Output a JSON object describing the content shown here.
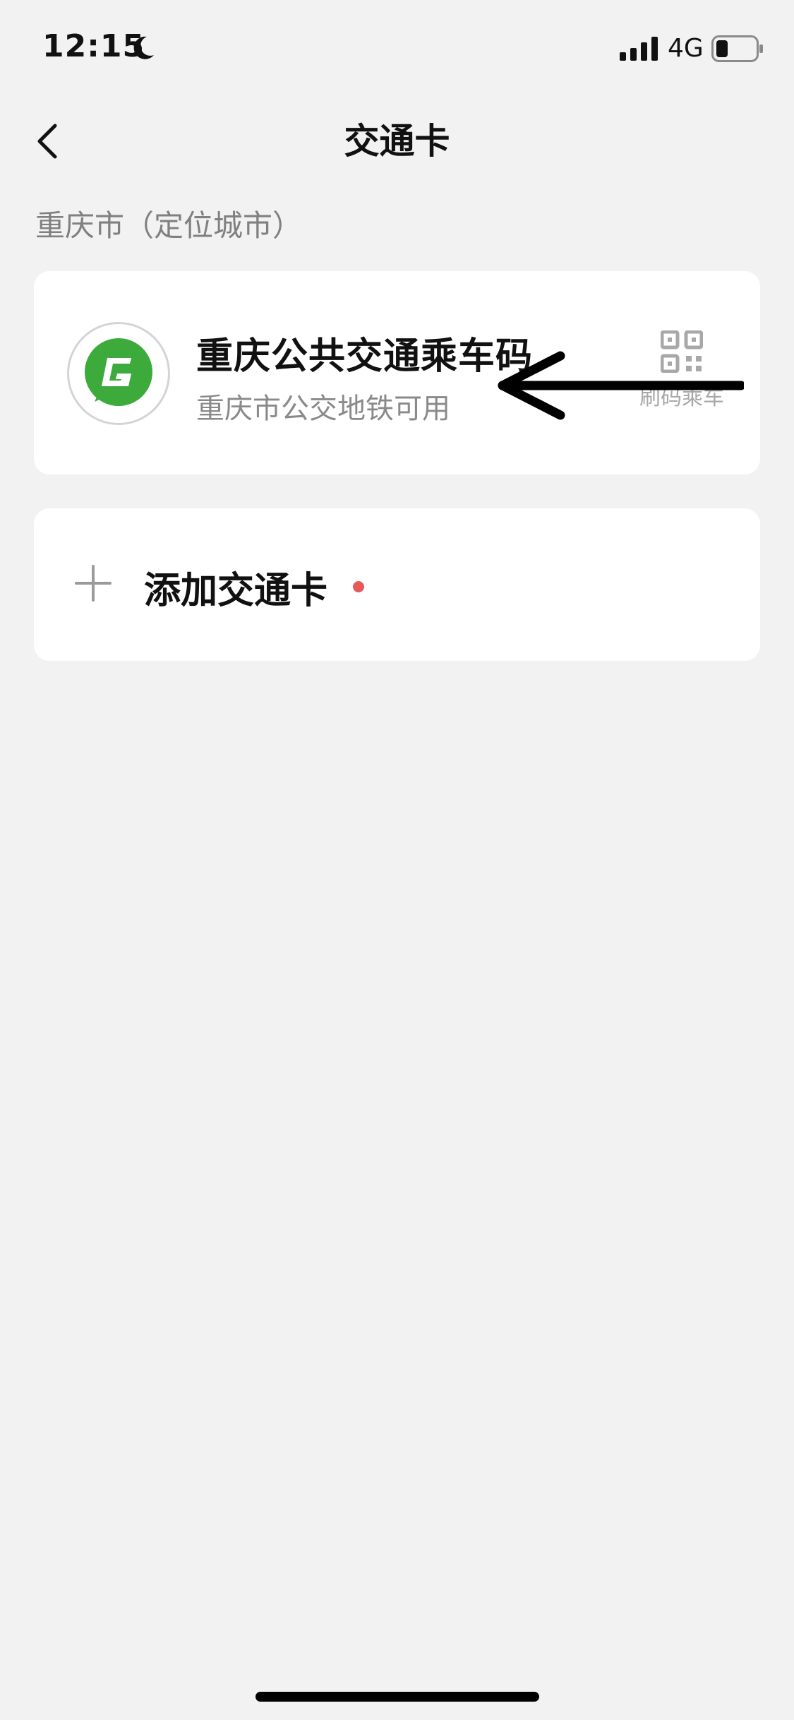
{
  "status_bar": {
    "time": "12:15",
    "network": "4G",
    "icons": [
      "moon-icon",
      "signal-icon",
      "battery-icon"
    ]
  },
  "nav": {
    "title": "交通卡",
    "back_icon": "chevron-left-icon"
  },
  "section": {
    "header": "重庆市（定位城市）"
  },
  "transit_card": {
    "title": "重庆公共交通乘车码",
    "subtitle": "重庆市公交地铁可用",
    "action_label": "刷码乘车",
    "logo_icon": "transit-logo-icon",
    "logo_color": "#3cab3c"
  },
  "add_card": {
    "label": "添加交通卡",
    "icon": "plus-icon",
    "dot_color": "#e85a5a"
  },
  "colors": {
    "background": "#f2f2f2",
    "card": "#ffffff",
    "primary_text": "#111111",
    "secondary_text": "#8a8a8a"
  }
}
